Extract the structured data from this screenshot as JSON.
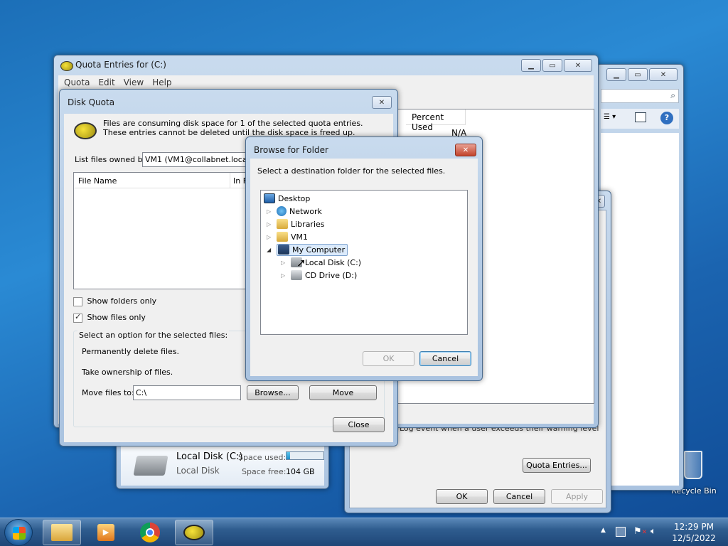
{
  "desktop": {
    "recycle_bin_label": "Recycle Bin"
  },
  "quota_entries_window": {
    "title": "Quota Entries for  (C:)",
    "menu": [
      "Quota",
      "Edit",
      "View",
      "Help"
    ],
    "column_header": "Percent Used",
    "cell_value": "N/A"
  },
  "explorer_window": {
    "disk_name": "Local Disk (C:)",
    "disk_type": "Local Disk",
    "space_used_label": "Space used:",
    "space_free_label": "Space free:",
    "space_free_value": "104 GB",
    "space_used_fraction": 0.1
  },
  "properties_window": {
    "partial_text": "Log event when a user exceeds their warning level",
    "quota_entries_button": "Quota Entries...",
    "ok_button": "OK",
    "cancel_button": "Cancel",
    "apply_button": "Apply"
  },
  "disk_quota_dialog": {
    "title": "Disk Quota",
    "message": "Files are consuming disk space for 1 of the selected quota entries.  These entries cannot be deleted until the disk space is freed up.",
    "list_owned_label": "List files owned by:",
    "owner_value": "VM1 (VM1@collabnet.local) (0",
    "col_file_name": "File Name",
    "col_in_folder": "In F",
    "show_folders_only": "Show folders only",
    "show_folders_checked": false,
    "show_files_only": "Show files only",
    "show_files_checked": true,
    "option_group_label": "Select an option for the selected files:",
    "permanently_delete": "Permanently delete files.",
    "take_ownership": "Take ownership of files.",
    "move_files_label": "Move files to:",
    "move_path_value": "C:\\",
    "browse_button": "Browse...",
    "move_button": "Move",
    "close_button": "Close"
  },
  "browse_dialog": {
    "title": "Browse for Folder",
    "instruction": "Select a destination folder for the selected files.",
    "tree": [
      {
        "label": "Desktop",
        "icon": "desktop-icon"
      },
      {
        "label": "Network",
        "icon": "network-icon"
      },
      {
        "label": "Libraries",
        "icon": "libraries-icon"
      },
      {
        "label": "VM1",
        "icon": "user-folder-icon"
      },
      {
        "label": "My Computer",
        "icon": "computer-icon",
        "selected": true
      },
      {
        "label": "Local Disk (C:)",
        "icon": "hard-drive-icon"
      },
      {
        "label": "CD Drive (D:)",
        "icon": "cd-drive-icon"
      }
    ],
    "ok_button": "OK",
    "cancel_button": "Cancel"
  },
  "taskbar": {
    "time": "12:29 PM",
    "date": "12/5/2022"
  }
}
